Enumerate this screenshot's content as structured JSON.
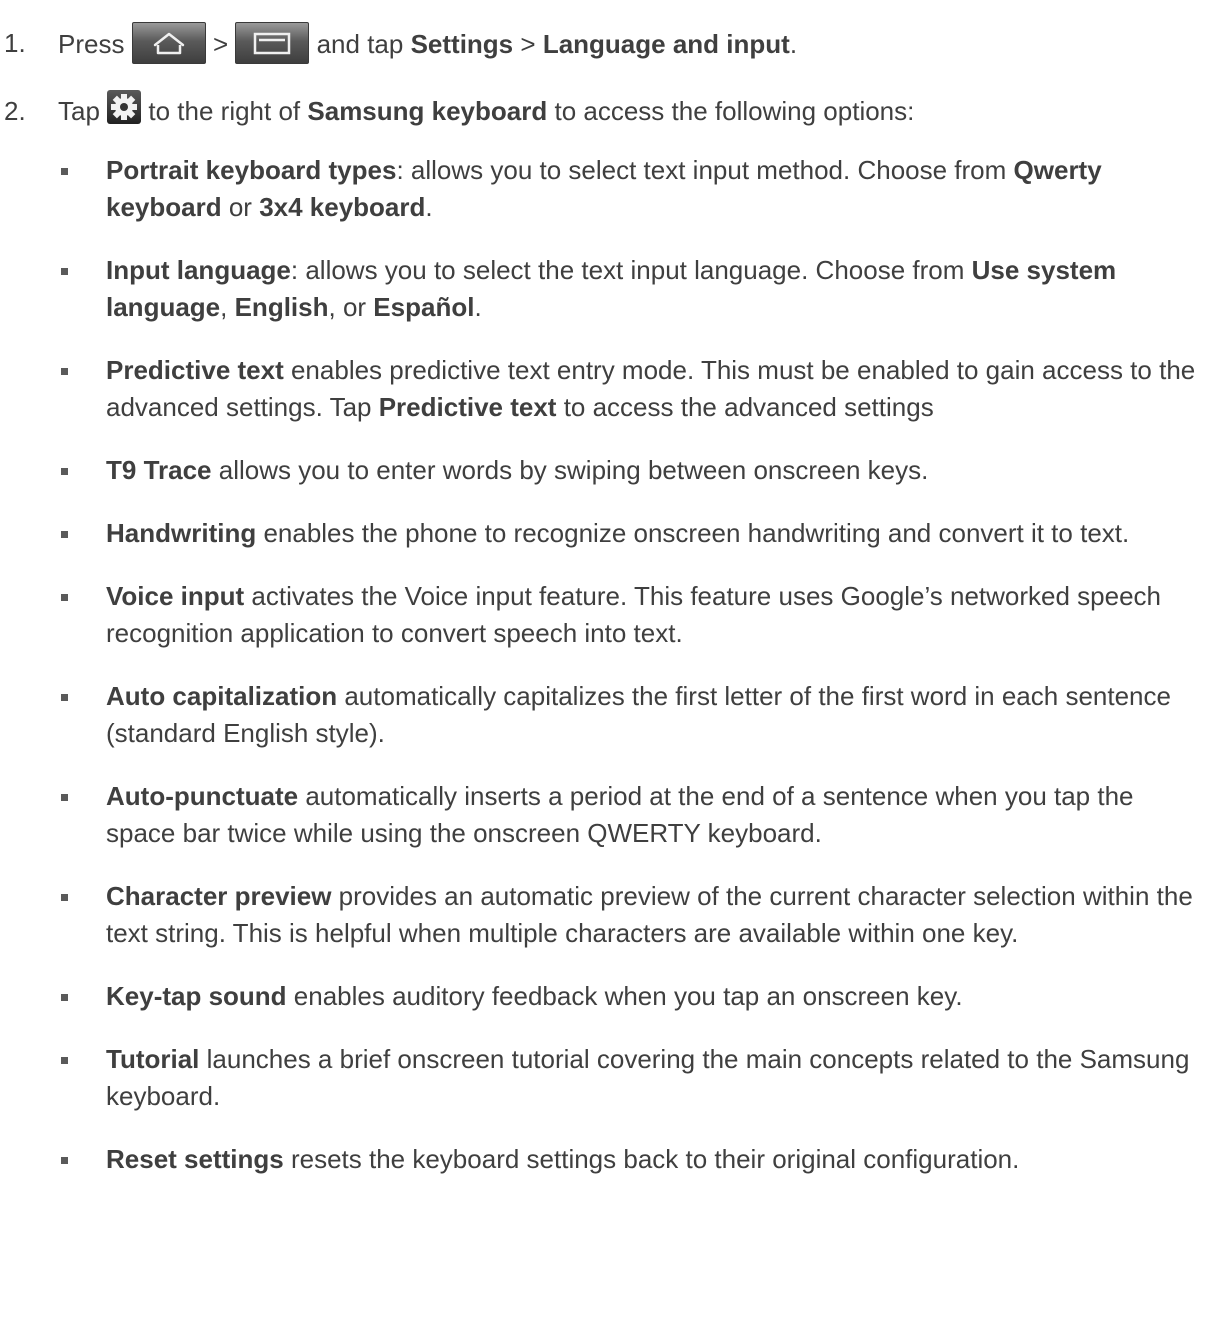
{
  "steps": [
    {
      "number": "1.",
      "text_press": "Press",
      "sep": ">",
      "text_and_tap": "and tap",
      "settings": "Settings",
      "gt": ">",
      "lang_input": "Language and input",
      "period": "."
    },
    {
      "number": "2.",
      "tap": "Tap",
      "to_right": "to the right of",
      "samsung_kb": "Samsung keyboard",
      "access": "to access the following options:"
    }
  ],
  "icons": {
    "home": "home-key-icon",
    "menu": "menu-key-icon",
    "settings": "gear-icon"
  },
  "options": [
    {
      "term": "Portrait keyboard types",
      "p1": ": allows you to select text input method. Choose from ",
      "b1": "Qwerty keyboard",
      "p2": " or ",
      "b2": "3x4 keyboard",
      "p3": "."
    },
    {
      "term": "Input language",
      "p1": ": allows you to select the text input language. Choose from ",
      "b1": "Use system language",
      "p2": ", ",
      "b2": "English",
      "p3": ", or ",
      "b3": "Español",
      "p4": "."
    },
    {
      "term": "Predictive text",
      "p1": " enables predictive text entry mode. This must be enabled to gain access to the advanced settings. Tap ",
      "b1": "Predictive text",
      "p2": " to access the advanced settings"
    },
    {
      "term": "T9 Trace",
      "p1": " allows you to enter words by swiping between onscreen keys."
    },
    {
      "term": "Handwriting",
      "p1": " enables the phone to recognize onscreen handwriting and convert it to text."
    },
    {
      "term": "Voice input",
      "p1": " activates the Voice input feature. This feature uses Google’s networked speech recognition application to convert speech into text."
    },
    {
      "term": "Auto capitalization",
      "p1": " automatically capitalizes the first letter of the first word in each sentence (standard English style)."
    },
    {
      "term": "Auto-punctuate",
      "p1": " automatically inserts a period at the end of a sentence when you tap the space bar twice while using the onscreen QWERTY keyboard."
    },
    {
      "term": "Character preview",
      "p1": " provides an automatic preview of the current character selection within the text string. This is helpful when multiple characters are available within one key."
    },
    {
      "term": "Key-tap sound",
      "p1": " enables auditory feedback when you tap an onscreen key."
    },
    {
      "term": "Tutorial",
      "p1": " launches a brief onscreen tutorial covering the main concepts related to the Samsung keyboard."
    },
    {
      "term": "Reset settings",
      "p1": " resets the keyboard settings back to their original configuration."
    }
  ]
}
